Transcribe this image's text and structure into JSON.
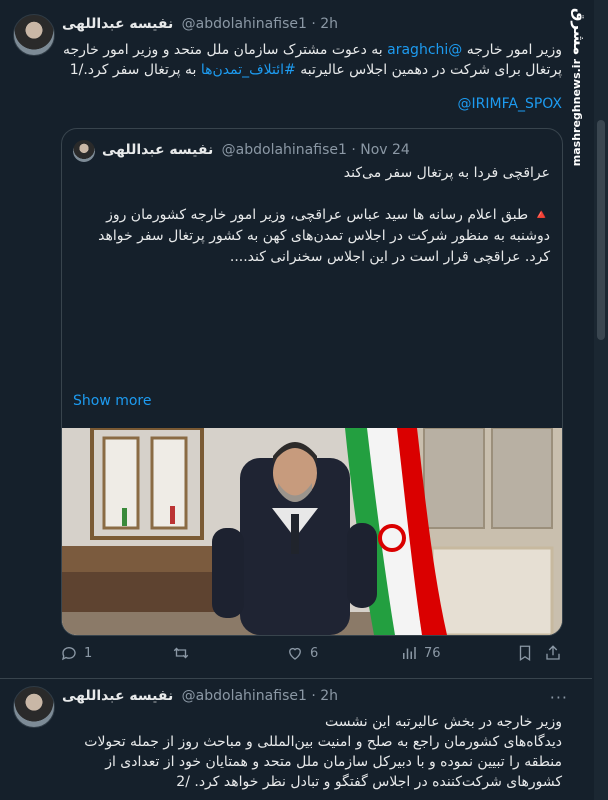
{
  "tweet1": {
    "author_name": "نفیسه عبداللهی",
    "author_handle": "@abdolahinafise1",
    "sep": "·",
    "time": "2h",
    "lines": [
      {
        "prefix": "وزیر امور خارجه ",
        "mention": "@araghchi",
        "suffix": " به دعوت مشترک سازمان ملل متحد و وزیر امور خارجه"
      },
      {
        "text_a": "پرتغال برای شرکت در دهمین اجلاس عالیرتبه ",
        "hashtag": "#ائتلاف_تمدن‌ها",
        "text_b": " به پرتغال سفر کرد./1"
      }
    ],
    "mention2": "@IRIMFA_SPOX",
    "quote": {
      "author_name": "نفیسه عبداللهی",
      "author_handle": "@abdolahinafise1",
      "sep": "·",
      "date": "Nov 24",
      "headline": "عراقچی فردا به پرتغال سفر می‌کند",
      "body_lines": [
        "🔺 طبق اعلام رسانه ها سید عباس عراقچی، وزیر امور خارجه کشورمان روز",
        "دوشنبه به منظور شرکت در اجلاس تمدن‌های کهن به کشور پرتغال سفر خواهد",
        "کرد. عراقچی قرار است در این اجلاس سخنرانی کند...."
      ],
      "show_more": "Show more"
    },
    "actions": {
      "replies": "1",
      "retweets": "",
      "likes": "6",
      "views": "76"
    }
  },
  "tweet2": {
    "author_name": "نفیسه عبداللهی",
    "author_handle": "@abdolahinafise1",
    "sep": "·",
    "time": "2h",
    "more": "···",
    "lines": [
      "وزیر خارجه در بخش عالیرتبه این نشست",
      "دیدگاه‌های کشورمان راجع به صلح و امنیت بین‌المللی و مباحث روز از جمله تحولات",
      "منطقه را تبیین نموده و با دبیرکل سازمان ملل متحد و همتایان خود از تعدادی از",
      "کشورهای شرکت‌کننده در اجلاس گفتگو و تبادل نظر خواهد کرد. /2"
    ]
  },
  "watermark": {
    "logo": "مشرق",
    "site": "mashreghnews.ir"
  },
  "colors": {
    "background": "#15202b",
    "text": "#e7e9ea",
    "muted": "#8b98a5",
    "link": "#1d9bf0",
    "border": "#38444d"
  }
}
